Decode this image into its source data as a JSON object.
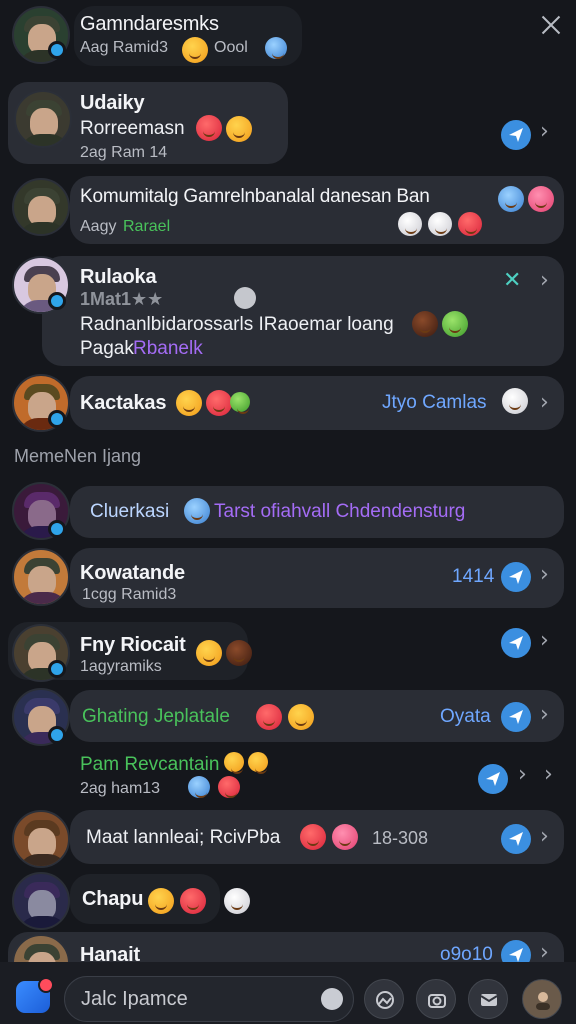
{
  "close_label": "×",
  "rows": [
    {
      "name": "Gamndaresmks",
      "sub": "Aag Ramid3",
      "extra": "Oool"
    },
    {
      "name": "Udaiky",
      "line2": "Rorreemasn",
      "sub": "2ag Ram 14"
    },
    {
      "name": "Komumitalg Gamrelnbanalal danesan Ban",
      "sub": "Aagy",
      "sub_accent": "Rarael"
    },
    {
      "name": "Rulaoka",
      "sub": "1Mat1★★",
      "line2": "Radnanlbidarossarls IRaoemar loang",
      "line3": "Pagak",
      "line3_accent": "Rbanelk"
    },
    {
      "name": "Kactakas",
      "meta": "Jtyo Camlas"
    },
    {
      "name": "Cluerkasi",
      "line2": "Tarst ofiahvall Chdendensturg"
    },
    {
      "name": "Kowatande",
      "sub": "1cgg Ramid3",
      "meta": "1414"
    },
    {
      "name": "Fny Riocait",
      "sub": "1agyramiks"
    },
    {
      "name": "Ghating Jeplatale",
      "meta": "Oyata"
    },
    {
      "name": "Pam Revcantain",
      "sub": "2ag ham13"
    },
    {
      "name": "Maat lannleai; RcivPba",
      "meta": "18-308"
    },
    {
      "name": "Chapu"
    },
    {
      "name": "Hanait",
      "meta": "o9o10"
    }
  ],
  "section_label": "MemeNen Ijang",
  "composer": {
    "placeholder": "Jalc Ipamce"
  },
  "colors": {
    "accent": "#3b8fe0",
    "green": "#49c25b",
    "purple": "#a46cf5",
    "bubble": "#2a2d35"
  },
  "icons": [
    "close-icon",
    "send-icon",
    "chevron-right-icon",
    "app-icon",
    "gallery-icon",
    "camera-icon",
    "mail-icon",
    "profile-avatar"
  ]
}
